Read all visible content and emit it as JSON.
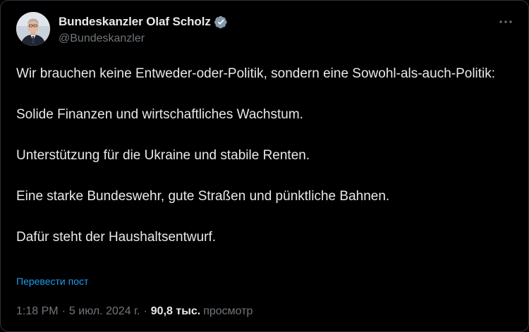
{
  "author": {
    "name": "Bundeskanzler Olaf Scholz",
    "handle": "@Bundeskanzler",
    "verified": true,
    "avatar_icon": "profile-photo"
  },
  "tweet": {
    "paragraphs": [
      "Wir brauchen keine Entweder-oder-Politik, sondern eine Sowohl-als-auch-Politik:",
      "Solide Finanzen und wirtschaftliches Wachstum.",
      "Unterstützung für die Ukraine und stabile Renten.",
      "Eine starke Bundeswehr, gute Straßen und pünktliche Bahnen.",
      "Dafür steht der Haushaltsentwurf."
    ],
    "translate_label": "Перевести пост"
  },
  "meta": {
    "time": "1:18 PM",
    "date": "5 июл. 2024 г.",
    "views_count": "90,8 тыс.",
    "views_label": "просмотр",
    "separator": "·"
  },
  "colors": {
    "background": "#000000",
    "text": "#e7e9ea",
    "muted": "#71767b",
    "link": "#1d9bf0",
    "verified_badge": "#829aab"
  },
  "icons": {
    "verified": "verified-badge-icon",
    "more": "more-options-icon"
  }
}
